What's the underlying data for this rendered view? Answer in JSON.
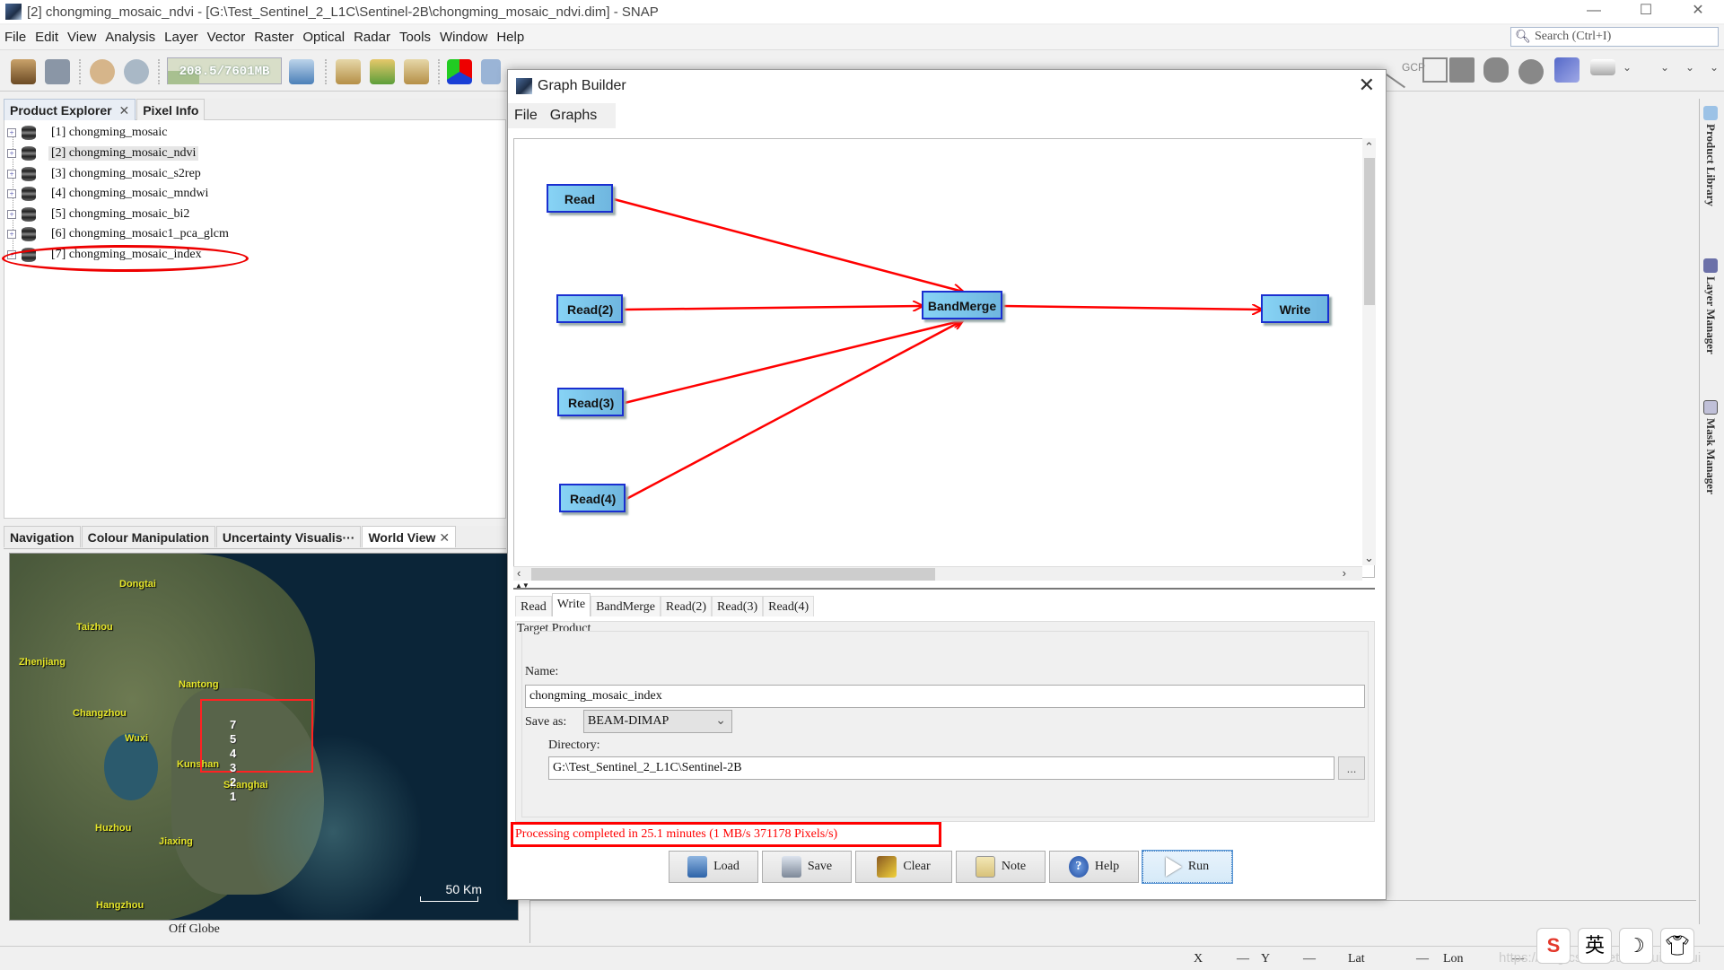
{
  "window": {
    "title": "[2] chongming_mosaic_ndvi - [G:\\Test_Sentinel_2_L1C\\Sentinel-2B\\chongming_mosaic_ndvi.dim] - SNAP",
    "controls": {
      "minimize": "—",
      "maximize": "☐",
      "close": "✕"
    }
  },
  "menubar": [
    "File",
    "Edit",
    "View",
    "Analysis",
    "Layer",
    "Vector",
    "Raster",
    "Optical",
    "Radar",
    "Tools",
    "Window",
    "Help"
  ],
  "search": {
    "placeholder": "Search (Ctrl+I)"
  },
  "toolbar": {
    "memory": {
      "label": "208.5/7601MB",
      "used_fraction": 0.027
    },
    "icons": [
      "open-product-icon",
      "save-product-icon",
      "undo-icon",
      "redo-icon",
      "gc-icon",
      "new-product-icon",
      "import-icon",
      "export-icon",
      "rgb-icon",
      "windows-icon",
      "world-icon",
      "rect-tool-icon",
      "draw-icon",
      "gcp-tool-icon",
      "line-tool-icon",
      "polyline-tool-icon",
      "rect-draw-icon",
      "polygon-tool-icon",
      "ellipse-tool-icon",
      "vector-tool-icon",
      "range-finder-icon"
    ],
    "gcp_label": "GCP"
  },
  "product_explorer": {
    "tabs": [
      {
        "label": "Product Explorer",
        "closable": true
      },
      {
        "label": "Pixel Info",
        "closable": false
      }
    ],
    "products": [
      {
        "id": "[1]",
        "name": "chongming_mosaic"
      },
      {
        "id": "[2]",
        "name": "chongming_mosaic_ndvi",
        "selected": true
      },
      {
        "id": "[3]",
        "name": "chongming_mosaic_s2rep"
      },
      {
        "id": "[4]",
        "name": "chongming_mosaic_mndwi"
      },
      {
        "id": "[5]",
        "name": "chongming_mosaic_bi2"
      },
      {
        "id": "[6]",
        "name": "chongming_mosaic1_pca_glcm"
      },
      {
        "id": "[7]",
        "name": "chongming_mosaic_index",
        "highlighted": true
      }
    ]
  },
  "bottom_tabs": [
    {
      "label": "Navigation"
    },
    {
      "label": "Colour Manipulation"
    },
    {
      "label": "Uncertainty Visualis···"
    },
    {
      "label": "World View",
      "active": true,
      "closable": true
    }
  ],
  "world_view": {
    "cities": [
      "Dongtai",
      "Taizhou",
      "Zhenjiang",
      "Nantong",
      "Changzhou",
      "Wuxi",
      "Kunshan",
      "Shanghai",
      "Huzhou",
      "Jiaxing",
      "Hangzhou"
    ],
    "product_markers": [
      "7",
      "5",
      "4",
      "3",
      "2",
      "1"
    ],
    "scale_label": "50 Km",
    "footer": "Off Globe"
  },
  "right_strip": [
    "Product Library",
    "Layer Manager",
    "Mask Manager"
  ],
  "graph_builder": {
    "title": "Graph Builder",
    "close": "✕",
    "menu": [
      "File",
      "Graphs"
    ],
    "nodes": [
      {
        "id": "Read",
        "label": "Read"
      },
      {
        "id": "Read2",
        "label": "Read(2)"
      },
      {
        "id": "Read3",
        "label": "Read(3)"
      },
      {
        "id": "Read4",
        "label": "Read(4)"
      },
      {
        "id": "BandMerge",
        "label": "BandMerge"
      },
      {
        "id": "Write",
        "label": "Write"
      }
    ],
    "edges": [
      {
        "from": "Read",
        "to": "BandMerge"
      },
      {
        "from": "Read2",
        "to": "BandMerge"
      },
      {
        "from": "Read3",
        "to": "BandMerge"
      },
      {
        "from": "Read4",
        "to": "BandMerge"
      },
      {
        "from": "BandMerge",
        "to": "Write"
      }
    ],
    "tabs": [
      "Read",
      "Write",
      "BandMerge",
      "Read(2)",
      "Read(3)",
      "Read(4)"
    ],
    "active_tab": "Write",
    "target_product": {
      "group_label": "Target Product",
      "name_label": "Name:",
      "name_value": "chongming_mosaic_index",
      "save_as_label": "Save as:",
      "save_as_value": "BEAM-DIMAP",
      "directory_label": "Directory:",
      "directory_value": "G:\\Test_Sentinel_2_L1C\\Sentinel-2B",
      "browse_label": "..."
    },
    "status": "Processing completed in 25.1 minutes (1 MB/s 371178 Pixels/s)",
    "buttons": [
      {
        "label": "Load",
        "icon": "load-icon"
      },
      {
        "label": "Save",
        "icon": "save-icon"
      },
      {
        "label": "Clear",
        "icon": "broom-icon"
      },
      {
        "label": "Note",
        "icon": "note-icon"
      },
      {
        "label": "Help",
        "icon": "help-icon"
      },
      {
        "label": "Run",
        "icon": "play-icon"
      }
    ]
  },
  "status_bar": {
    "x_label": "X",
    "x_value": "—",
    "y_label": "Y",
    "y_value": "—",
    "lat_label": "Lat",
    "lat_value": "—",
    "lon_label": "Lon",
    "lon_value": "—"
  },
  "tray": {
    "ime_lang": "英",
    "watermark": "https://blog.csdn.net/lidahuilidahui"
  }
}
